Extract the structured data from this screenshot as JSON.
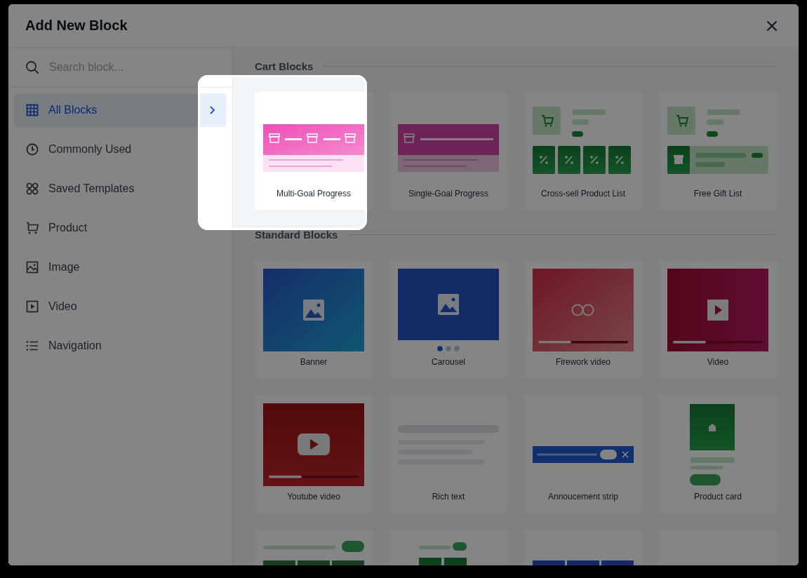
{
  "window": {
    "title": "Add New Block"
  },
  "search": {
    "placeholder": "Search block..."
  },
  "sidebar": {
    "items": [
      {
        "label": "All Blocks",
        "selected": true
      },
      {
        "label": "Commonly Used",
        "selected": false
      },
      {
        "label": "Saved Templates",
        "selected": false
      },
      {
        "label": "Product",
        "selected": false
      },
      {
        "label": "Image",
        "selected": false
      },
      {
        "label": "Video",
        "selected": false
      },
      {
        "label": "Navigation",
        "selected": false
      }
    ]
  },
  "sections": [
    {
      "title": "Cart Blocks",
      "cards": [
        {
          "label": "Multi-Goal Progress",
          "kind": "multi-goal",
          "highlighted": true
        },
        {
          "label": "Single-Goal Progress",
          "kind": "single-goal",
          "highlighted": false
        },
        {
          "label": "Cross-sell Product List",
          "kind": "cross-sell",
          "highlighted": false
        },
        {
          "label": "Free Gift List",
          "kind": "free-gift",
          "highlighted": false
        }
      ]
    },
    {
      "title": "Standard Blocks",
      "cards": [
        {
          "label": "Banner",
          "kind": "banner",
          "highlighted": false
        },
        {
          "label": "Carousel",
          "kind": "carousel",
          "highlighted": false
        },
        {
          "label": "Firework video",
          "kind": "firework",
          "highlighted": false
        },
        {
          "label": "Video",
          "kind": "video",
          "highlighted": false
        },
        {
          "label": "Youtube video",
          "kind": "youtube",
          "highlighted": false
        },
        {
          "label": "Rich text",
          "kind": "rich-text",
          "highlighted": false
        },
        {
          "label": "Annoucement strip",
          "kind": "announcement",
          "highlighted": false
        },
        {
          "label": "Product card",
          "kind": "product-card",
          "highlighted": false
        },
        {
          "kind": "product-row"
        },
        {
          "kind": "product-pair"
        },
        {
          "kind": "blue-row"
        },
        {
          "kind": "blank"
        }
      ]
    }
  ]
}
